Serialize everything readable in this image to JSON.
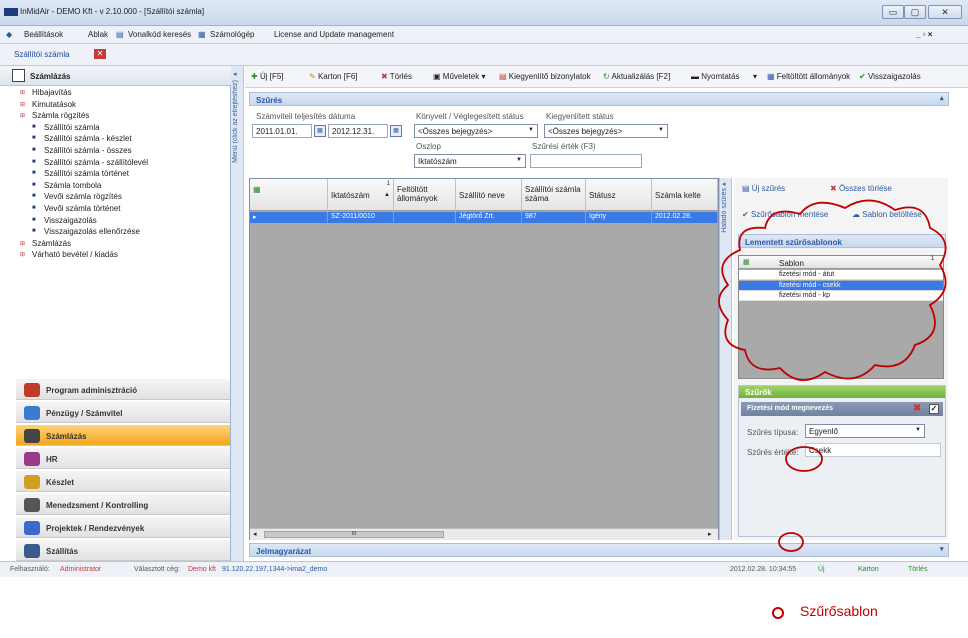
{
  "window": {
    "title": "InMidAir - DEMO Kft - v 2.10.000 - [Szállítói számla]",
    "minimize": "▭",
    "maximize": "▢",
    "close": "✕"
  },
  "menu": {
    "items": [
      "Beállítások",
      "Ablak",
      "Vonalkód keresés",
      "Számológép",
      "License and Update management"
    ],
    "right": "_ ▫ ×"
  },
  "tab": {
    "label": "Szállítói számla",
    "close": "✕"
  },
  "left_panel": {
    "title": "Számlázás",
    "tree": [
      {
        "label": "Hibajavítás",
        "level": 0
      },
      {
        "label": "Kimutatások",
        "level": 0
      },
      {
        "label": "Számla rögzítés",
        "level": 0
      },
      {
        "label": "Szállítói számla",
        "level": 1
      },
      {
        "label": "Szállítói számla - készlet",
        "level": 1
      },
      {
        "label": "Szállítói számla - összes",
        "level": 1
      },
      {
        "label": "Szállítói számla - szállítólevél",
        "level": 1
      },
      {
        "label": "Szállítói számla történet",
        "level": 1
      },
      {
        "label": "Számla tombola",
        "level": 1
      },
      {
        "label": "Vevői számla rögzítés",
        "level": 1
      },
      {
        "label": "Vevői számla történet",
        "level": 1
      },
      {
        "label": "Visszaigazolás",
        "level": 1
      },
      {
        "label": "Visszaigazolás ellenőrzése",
        "level": 1
      },
      {
        "label": "Számlázás",
        "level": 0
      },
      {
        "label": "Várható bevétel / kiadás",
        "level": 0
      }
    ],
    "modules": [
      "Program adminisztráció",
      "Pénzügy / Számvitel",
      "Számlázás",
      "HR",
      "Készlet",
      "Menedzsment / Kontrolling",
      "Projektek / Rendezvények",
      "Szállítás"
    ],
    "active_module": "Számlázás",
    "vertical_label": "Menü (click az elrejtéshez)"
  },
  "toolbar": {
    "items": [
      "Új  [F5]",
      "Karton  [F6]",
      "Törlés",
      "Műveletek ▾",
      "Kiegyenlítő bizonylatok",
      "Aktualizálás [F2]",
      "Nyomtatás",
      "▾",
      "Feltöltött állományok",
      "Visszaigazolás"
    ]
  },
  "filter": {
    "title": "Szűrés",
    "date_label": "Számviteli teljesítés dátuma",
    "date_from": "2011.01.01.",
    "date_to": "2012.12.31.",
    "status_label": "Könyvelt / Véglegesített státus",
    "status_value": "<Összes bejegyzés>",
    "settled_label": "Kiegyenlített státus",
    "settled_value": "<Összes bejegyzés>",
    "column_label": "Oszlop",
    "column_value": "Iktatószám",
    "value_label": "Szűrési érték (F3)",
    "value": ""
  },
  "grid": {
    "headers": [
      "Iktatószám",
      "Feltöltött állományok",
      "Szállító neve",
      "Szállítói számla száma",
      "Státusz",
      "Számla kelte"
    ],
    "sort_marker": "1",
    "rows": [
      [
        "SZ-2011/0010",
        "",
        "Jégtörő Zrt.",
        "987",
        "Igény",
        "2012.02.28."
      ]
    ],
    "scroll": "III"
  },
  "right_panel": {
    "vertical_label": "Haladó szűrés",
    "new_filter": "Új szűrés",
    "delete_all": "Összes törlése",
    "save_template": "Szűrősablon mentése",
    "load_template": "Sablon betöltése",
    "saved_title": "Lementett szűrősablonok",
    "template_col": "Sablon",
    "template_sort": "1",
    "templates": [
      "fizetési mód - átut",
      "fizetési mód - csekk",
      "fizetési mód - kp"
    ],
    "selected_template": 1,
    "filters_title": "Szűrők",
    "filter_name": "Fizetési mód megnevezés",
    "filter_type_label": "Szűrés típusa:",
    "filter_type": "Egyenlő",
    "filter_value_label": "Szűrés értéke:",
    "filter_value": "Csekk"
  },
  "legend_bar": "Jelmagyarázat",
  "status": {
    "user_label": "Felhasználó:",
    "user": "Administrator",
    "company_label": "Választott cég:",
    "company": "Demo kft",
    "server": "91.120.22.197,1344->ima2_demo",
    "datetime": "2012.02.28. 10:34:55",
    "new": "Új",
    "card": "Karton",
    "delete": "Törlés"
  },
  "annotation": {
    "label": "Szűrősablon",
    "color": "#c00000"
  }
}
